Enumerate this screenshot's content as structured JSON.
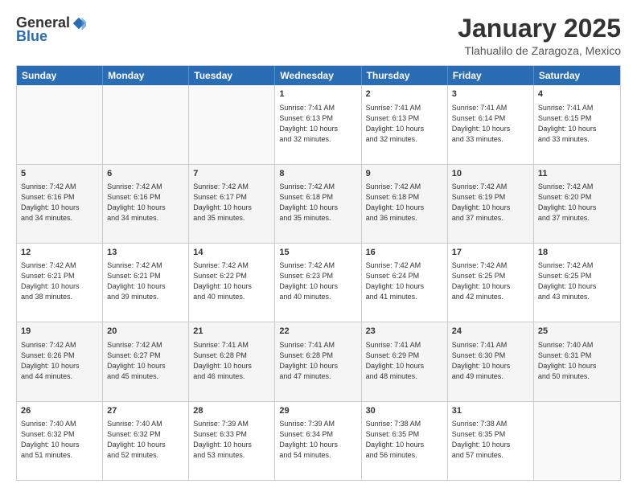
{
  "logo": {
    "general": "General",
    "blue": "Blue"
  },
  "title": "January 2025",
  "subtitle": "Tlahualilo de Zaragoza, Mexico",
  "headers": [
    "Sunday",
    "Monday",
    "Tuesday",
    "Wednesday",
    "Thursday",
    "Friday",
    "Saturday"
  ],
  "rows": [
    [
      {
        "day": "",
        "info": ""
      },
      {
        "day": "",
        "info": ""
      },
      {
        "day": "",
        "info": ""
      },
      {
        "day": "1",
        "info": "Sunrise: 7:41 AM\nSunset: 6:13 PM\nDaylight: 10 hours\nand 32 minutes."
      },
      {
        "day": "2",
        "info": "Sunrise: 7:41 AM\nSunset: 6:13 PM\nDaylight: 10 hours\nand 32 minutes."
      },
      {
        "day": "3",
        "info": "Sunrise: 7:41 AM\nSunset: 6:14 PM\nDaylight: 10 hours\nand 33 minutes."
      },
      {
        "day": "4",
        "info": "Sunrise: 7:41 AM\nSunset: 6:15 PM\nDaylight: 10 hours\nand 33 minutes."
      }
    ],
    [
      {
        "day": "5",
        "info": "Sunrise: 7:42 AM\nSunset: 6:16 PM\nDaylight: 10 hours\nand 34 minutes."
      },
      {
        "day": "6",
        "info": "Sunrise: 7:42 AM\nSunset: 6:16 PM\nDaylight: 10 hours\nand 34 minutes."
      },
      {
        "day": "7",
        "info": "Sunrise: 7:42 AM\nSunset: 6:17 PM\nDaylight: 10 hours\nand 35 minutes."
      },
      {
        "day": "8",
        "info": "Sunrise: 7:42 AM\nSunset: 6:18 PM\nDaylight: 10 hours\nand 35 minutes."
      },
      {
        "day": "9",
        "info": "Sunrise: 7:42 AM\nSunset: 6:18 PM\nDaylight: 10 hours\nand 36 minutes."
      },
      {
        "day": "10",
        "info": "Sunrise: 7:42 AM\nSunset: 6:19 PM\nDaylight: 10 hours\nand 37 minutes."
      },
      {
        "day": "11",
        "info": "Sunrise: 7:42 AM\nSunset: 6:20 PM\nDaylight: 10 hours\nand 37 minutes."
      }
    ],
    [
      {
        "day": "12",
        "info": "Sunrise: 7:42 AM\nSunset: 6:21 PM\nDaylight: 10 hours\nand 38 minutes."
      },
      {
        "day": "13",
        "info": "Sunrise: 7:42 AM\nSunset: 6:21 PM\nDaylight: 10 hours\nand 39 minutes."
      },
      {
        "day": "14",
        "info": "Sunrise: 7:42 AM\nSunset: 6:22 PM\nDaylight: 10 hours\nand 40 minutes."
      },
      {
        "day": "15",
        "info": "Sunrise: 7:42 AM\nSunset: 6:23 PM\nDaylight: 10 hours\nand 40 minutes."
      },
      {
        "day": "16",
        "info": "Sunrise: 7:42 AM\nSunset: 6:24 PM\nDaylight: 10 hours\nand 41 minutes."
      },
      {
        "day": "17",
        "info": "Sunrise: 7:42 AM\nSunset: 6:25 PM\nDaylight: 10 hours\nand 42 minutes."
      },
      {
        "day": "18",
        "info": "Sunrise: 7:42 AM\nSunset: 6:25 PM\nDaylight: 10 hours\nand 43 minutes."
      }
    ],
    [
      {
        "day": "19",
        "info": "Sunrise: 7:42 AM\nSunset: 6:26 PM\nDaylight: 10 hours\nand 44 minutes."
      },
      {
        "day": "20",
        "info": "Sunrise: 7:42 AM\nSunset: 6:27 PM\nDaylight: 10 hours\nand 45 minutes."
      },
      {
        "day": "21",
        "info": "Sunrise: 7:41 AM\nSunset: 6:28 PM\nDaylight: 10 hours\nand 46 minutes."
      },
      {
        "day": "22",
        "info": "Sunrise: 7:41 AM\nSunset: 6:28 PM\nDaylight: 10 hours\nand 47 minutes."
      },
      {
        "day": "23",
        "info": "Sunrise: 7:41 AM\nSunset: 6:29 PM\nDaylight: 10 hours\nand 48 minutes."
      },
      {
        "day": "24",
        "info": "Sunrise: 7:41 AM\nSunset: 6:30 PM\nDaylight: 10 hours\nand 49 minutes."
      },
      {
        "day": "25",
        "info": "Sunrise: 7:40 AM\nSunset: 6:31 PM\nDaylight: 10 hours\nand 50 minutes."
      }
    ],
    [
      {
        "day": "26",
        "info": "Sunrise: 7:40 AM\nSunset: 6:32 PM\nDaylight: 10 hours\nand 51 minutes."
      },
      {
        "day": "27",
        "info": "Sunrise: 7:40 AM\nSunset: 6:32 PM\nDaylight: 10 hours\nand 52 minutes."
      },
      {
        "day": "28",
        "info": "Sunrise: 7:39 AM\nSunset: 6:33 PM\nDaylight: 10 hours\nand 53 minutes."
      },
      {
        "day": "29",
        "info": "Sunrise: 7:39 AM\nSunset: 6:34 PM\nDaylight: 10 hours\nand 54 minutes."
      },
      {
        "day": "30",
        "info": "Sunrise: 7:38 AM\nSunset: 6:35 PM\nDaylight: 10 hours\nand 56 minutes."
      },
      {
        "day": "31",
        "info": "Sunrise: 7:38 AM\nSunset: 6:35 PM\nDaylight: 10 hours\nand 57 minutes."
      },
      {
        "day": "",
        "info": ""
      }
    ]
  ]
}
